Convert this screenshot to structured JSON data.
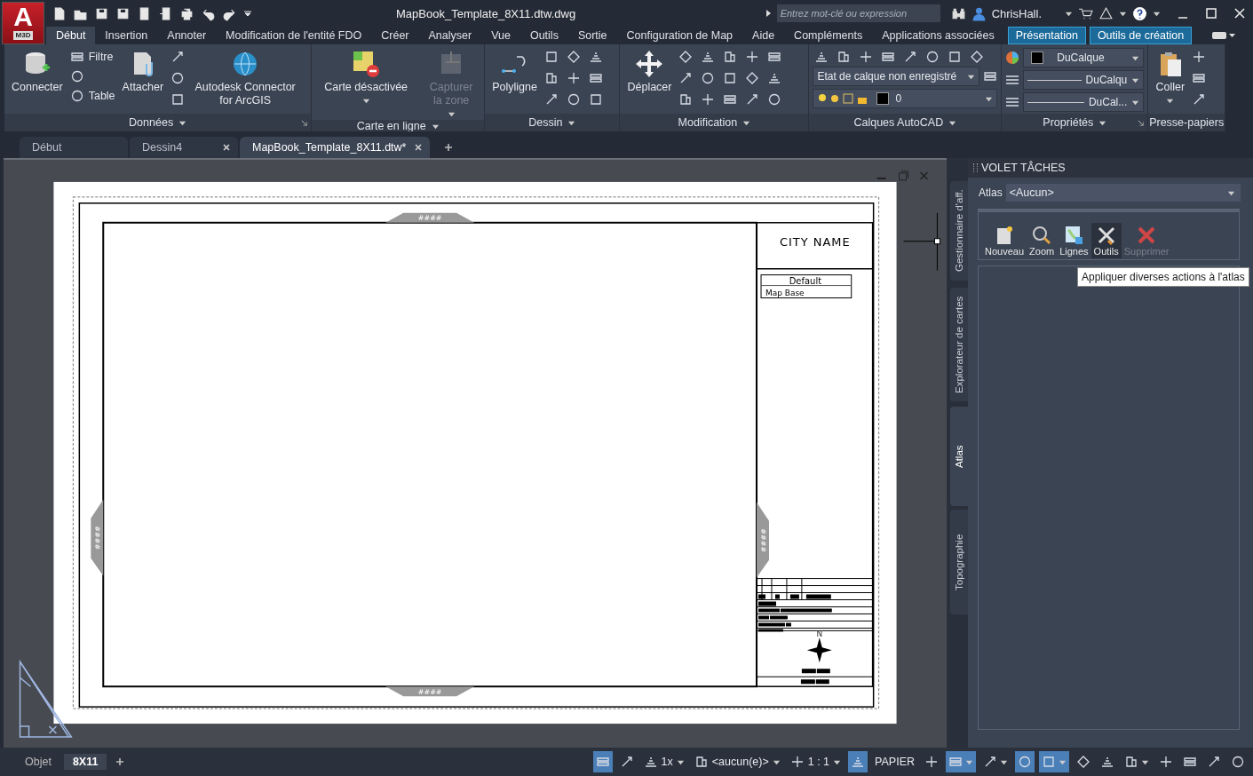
{
  "app": {
    "logo_letter": "A",
    "logo_badge": "M3D"
  },
  "window": {
    "title": "MapBook_Template_8X11.dtw.dwg"
  },
  "search": {
    "placeholder": "Entrez mot-clé ou expression"
  },
  "user": {
    "name": "ChrisHall."
  },
  "menu_tabs": [
    {
      "label": "Début",
      "selected": true,
      "kind": "normal"
    },
    {
      "label": "Insertion",
      "selected": false,
      "kind": "normal"
    },
    {
      "label": "Annoter",
      "selected": false,
      "kind": "normal"
    },
    {
      "label": "Modification de l'entité FDO",
      "selected": false,
      "kind": "normal"
    },
    {
      "label": "Créer",
      "selected": false,
      "kind": "normal"
    },
    {
      "label": "Analyser",
      "selected": false,
      "kind": "normal"
    },
    {
      "label": "Vue",
      "selected": false,
      "kind": "normal"
    },
    {
      "label": "Outils",
      "selected": false,
      "kind": "normal"
    },
    {
      "label": "Sortie",
      "selected": false,
      "kind": "normal"
    },
    {
      "label": "Configuration de Map",
      "selected": false,
      "kind": "normal"
    },
    {
      "label": "Aide",
      "selected": false,
      "kind": "normal"
    },
    {
      "label": "Compléments",
      "selected": false,
      "kind": "normal"
    },
    {
      "label": "Applications associées",
      "selected": false,
      "kind": "normal"
    },
    {
      "label": "Présentation",
      "selected": false,
      "kind": "contextual"
    },
    {
      "label": "Outils de création",
      "selected": false,
      "kind": "contextual"
    }
  ],
  "ribbon": [
    {
      "title": "Données",
      "launcher": true,
      "groups": [
        {
          "kind": "big",
          "label": "Connecter",
          "dropdown": false,
          "disabled": false
        },
        {
          "kind": "smalls",
          "items": [
            {
              "kind": "labeled",
              "label": "Filtre"
            },
            {
              "kind": "icon"
            },
            {
              "kind": "labeled",
              "label": "Table"
            }
          ]
        },
        {
          "kind": "big",
          "label": "Attacher",
          "dropdown": false,
          "disabled": false
        },
        {
          "kind": "icons"
        },
        {
          "kind": "big",
          "label": "Autodesk Connector for ArcGIS",
          "dropdown": false,
          "disabled": false
        }
      ]
    },
    {
      "title": "Carte en ligne",
      "groups": [
        {
          "kind": "big",
          "label": "Carte désactivée",
          "dropdown": true,
          "disabled": false
        },
        {
          "kind": "big",
          "label": "Capturer la zone",
          "dropdown": true,
          "disabled": true
        }
      ]
    },
    {
      "title": "Dessin",
      "groups": [
        {
          "kind": "big",
          "label": "Polyligne",
          "dropdown": false,
          "disabled": false
        },
        {
          "kind": "icons"
        }
      ]
    },
    {
      "title": "Modification",
      "groups": [
        {
          "kind": "big",
          "label": "Déplacer",
          "dropdown": false,
          "disabled": false
        },
        {
          "kind": "icons"
        }
      ]
    },
    {
      "title": "Calques AutoCAD",
      "groups": [
        {
          "kind": "icons"
        },
        {
          "kind": "dropdown",
          "value": "Etat de calque non enregistré"
        },
        {
          "kind": "dropdown",
          "value": "0"
        }
      ]
    },
    {
      "title": "Propriétés",
      "launcher": true,
      "groups": [
        {
          "kind": "dropdown",
          "value": "DuCalque"
        },
        {
          "kind": "dropdown",
          "value": "DuCalqu"
        },
        {
          "kind": "dropdown",
          "value": "DuCal..."
        }
      ]
    },
    {
      "title": "Presse-papiers",
      "groups": [
        {
          "kind": "big",
          "label": "Coller",
          "dropdown": true,
          "disabled": false
        },
        {
          "kind": "icons"
        }
      ]
    }
  ],
  "doc_tabs": [
    {
      "label": "Début",
      "selected": false,
      "closable": false
    },
    {
      "label": "Dessin4",
      "selected": false,
      "closable": true
    },
    {
      "label": "MapBook_Template_8X11.dtw*",
      "selected": true,
      "closable": true
    }
  ],
  "paper": {
    "city_name": "CITY NAME",
    "legend_header": "Default",
    "legend_item": "Map Base",
    "grid_refs": [
      "####",
      "####",
      "####",
      "####"
    ],
    "north": "N"
  },
  "task_pane": {
    "title": "VOLET TÂCHES",
    "side_tabs": [
      {
        "label": "Gestionnaire d'aff.",
        "selected": false
      },
      {
        "label": "Explorateur de cartes",
        "selected": false
      },
      {
        "label": "Atlas",
        "selected": true
      },
      {
        "label": "Topographie",
        "selected": false
      }
    ],
    "atlas_label": "Atlas",
    "atlas_value": "<Aucun>",
    "tools": [
      {
        "label": "Nouveau",
        "kind": "new",
        "disabled": false,
        "highlighted": false
      },
      {
        "label": "Zoom",
        "kind": "zoom",
        "disabled": false,
        "highlighted": false
      },
      {
        "label": "Lignes",
        "kind": "lines",
        "disabled": false,
        "highlighted": false
      },
      {
        "label": "Outils",
        "kind": "tools",
        "disabled": false,
        "highlighted": true
      },
      {
        "label": "Supprimer",
        "kind": "delete",
        "disabled": true,
        "highlighted": false
      }
    ],
    "tooltip": "Appliquer diverses actions à l'atlas"
  },
  "status_bar": {
    "layout_tabs": [
      {
        "label": "Objet",
        "selected": false
      },
      {
        "label": "8X11",
        "selected": true
      }
    ],
    "items": [
      {
        "kind": "toggle",
        "on": true,
        "caret": false
      },
      {
        "kind": "toggle",
        "on": false,
        "caret": false
      },
      {
        "kind": "labeled",
        "label": "1x",
        "caret": true
      },
      {
        "kind": "labeled",
        "label": "<aucun(e)>",
        "caret": true
      },
      {
        "kind": "labeled",
        "label": "1 : 1",
        "caret": true
      },
      {
        "kind": "toggle",
        "on": true,
        "caret": false
      },
      {
        "kind": "text",
        "label": "PAPIER"
      },
      {
        "kind": "toggle",
        "on": false,
        "caret": false
      },
      {
        "kind": "toggle",
        "on": true,
        "caret": true
      },
      {
        "kind": "toggle",
        "on": false,
        "caret": true
      },
      {
        "kind": "toggle",
        "on": true,
        "caret": false
      },
      {
        "kind": "toggle",
        "on": true,
        "caret": true
      },
      {
        "kind": "toggle",
        "on": false,
        "caret": false
      },
      {
        "kind": "toggle",
        "on": false,
        "caret": false
      },
      {
        "kind": "toggle",
        "on": false,
        "caret": true
      },
      {
        "kind": "toggle",
        "on": false,
        "caret": false
      },
      {
        "kind": "toggle",
        "on": false,
        "caret": false
      },
      {
        "kind": "toggle",
        "on": false,
        "caret": false
      },
      {
        "kind": "toggle",
        "on": false,
        "caret": false
      }
    ]
  }
}
